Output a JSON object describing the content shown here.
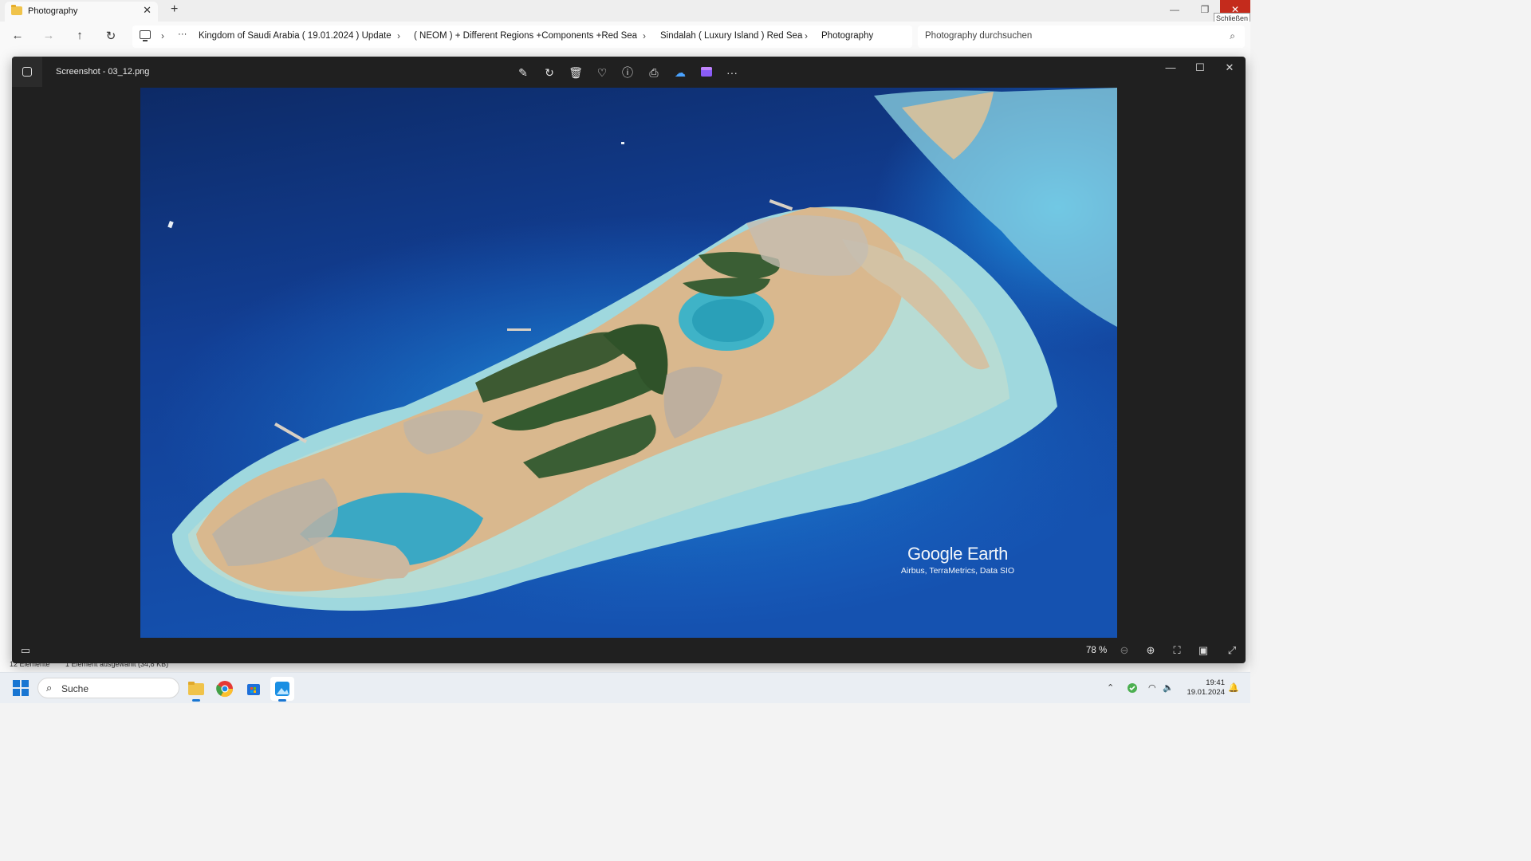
{
  "explorer": {
    "tab_title": "Photography",
    "tab_close": "✕",
    "new_tab": "+",
    "window_controls": {
      "minimize": "—",
      "restore": "❐",
      "close": "✕"
    },
    "tooltip": "Schließen",
    "nav": {
      "back": "←",
      "forward": "→",
      "up": "↑",
      "refresh": "↻"
    },
    "breadcrumb": {
      "overflow": "···",
      "items": [
        "Kingdom of Saudi Arabia ( 19.01.2024 ) Update",
        "( NEOM ) + Different Regions +Components +Red Sea",
        "Sindalah ( Luxury Island ) Red Sea",
        "Photography"
      ],
      "separator": "›"
    },
    "search_placeholder": "Photography durchsuchen",
    "status": {
      "item_count": "12 Elemente",
      "selection": "1 Element ausgewählt (34,8 KB)"
    }
  },
  "viewer": {
    "file_name": "Screenshot - 03_12.png",
    "toolbar": [
      "edit-image",
      "rotate",
      "delete",
      "favorite",
      "file-info",
      "print",
      "onedrive",
      "clipchamp",
      "more"
    ],
    "watermark": {
      "brand": "Google Earth",
      "credits": "Airbus, TerraMetrics, Data SIO"
    },
    "zoom_level": "78 %",
    "window_controls": {
      "minimize": "—",
      "maximize": "☐",
      "close": "✕"
    }
  },
  "taskbar": {
    "search_placeholder": "Suche",
    "time": "19:41",
    "date": "19.01.2024",
    "apps": [
      "file-explorer",
      "chrome",
      "microsoft-store",
      "photos"
    ]
  },
  "colors": {
    "accent": "#1976d2",
    "viewer_bg": "#202020",
    "close_red": "#c42b1c"
  }
}
